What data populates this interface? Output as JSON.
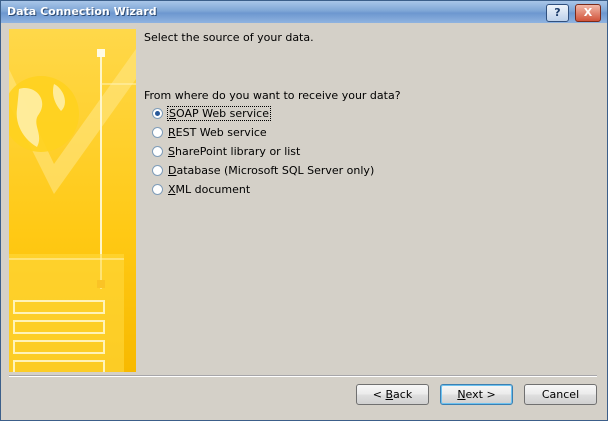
{
  "window": {
    "title": "Data Connection Wizard",
    "help_label": "?",
    "close_label": "X"
  },
  "content": {
    "heading": "Select the source of your data.",
    "question": "From where do you want to receive your data?"
  },
  "options": [
    {
      "prefix": "",
      "mnemonic": "S",
      "rest": "OAP Web service",
      "selected": true
    },
    {
      "prefix": "",
      "mnemonic": "R",
      "rest": "EST Web service",
      "selected": false
    },
    {
      "prefix": "",
      "mnemonic": "S",
      "rest": "harePoint library or list",
      "selected": false
    },
    {
      "prefix": "",
      "mnemonic": "D",
      "rest": "atabase (Microsoft SQL Server only)",
      "selected": false
    },
    {
      "prefix": "",
      "mnemonic": "X",
      "rest": "ML document",
      "selected": false
    }
  ],
  "buttons": {
    "back": {
      "prefix": "< ",
      "mnemonic": "B",
      "rest": "ack"
    },
    "next": {
      "prefix": "",
      "mnemonic": "N",
      "rest": "ext >"
    },
    "cancel": {
      "label": "Cancel"
    }
  },
  "colors": {
    "accent_yellow": "#ffc914",
    "titlebar": "#7fa6d6"
  }
}
